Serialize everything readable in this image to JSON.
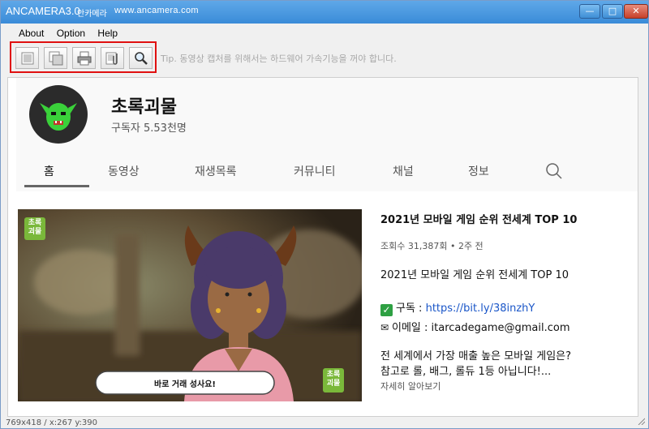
{
  "window": {
    "app_title": "ANCAMERA3.0",
    "app_title_kr": "안카메라",
    "url": "www.ancamera.com",
    "minimize": "—",
    "maximize": "□",
    "close": "✕"
  },
  "menu": [
    "About",
    "Option",
    "Help"
  ],
  "toolbar": {
    "tip": "Tip. 동영상 캡처를 위해서는 하드웨어 가속기능을 꺼야 합니다.",
    "buttons": [
      "capture-window-icon",
      "capture-region-icon",
      "print-icon",
      "clip-icon",
      "magnifier-icon"
    ]
  },
  "channel": {
    "name": "초록괴물",
    "subscribers": "구독자 5.53천명",
    "tabs": [
      "홈",
      "동영상",
      "재생목록",
      "커뮤니티",
      "채널",
      "정보"
    ],
    "active_tab": "홈"
  },
  "video": {
    "badge": "초록\n괴물",
    "badge_line1": "초록",
    "badge_line2": "괴물",
    "bubble": "바로 거래 성사요!",
    "title": "2021년 모바일 게임 순위 전세계 TOP 10",
    "meta": "조회수 31,387회 • 2주 전",
    "title2": "2021년 모바일 게임 순위 전세계 TOP 10",
    "subscribe_label": "구독 : ",
    "subscribe_link": "https://bit.ly/38inzhY",
    "email_label": "이메일 : itarcadegame@gmail.com",
    "desc_line1": "전 세계에서 가장 매출 높은 모바일 게임은?",
    "desc_line2": "참고로 롤, 배그, 롤듀 1등 아닙니다!...",
    "more": "자세히 알아보기"
  },
  "status": "769x418 / x:267 y:390",
  "colors": {
    "titlebar": "#3a8bd8",
    "toolbar_highlight": "#e01010",
    "link": "#1a56c8",
    "avatar_green": "#3ad13a"
  }
}
